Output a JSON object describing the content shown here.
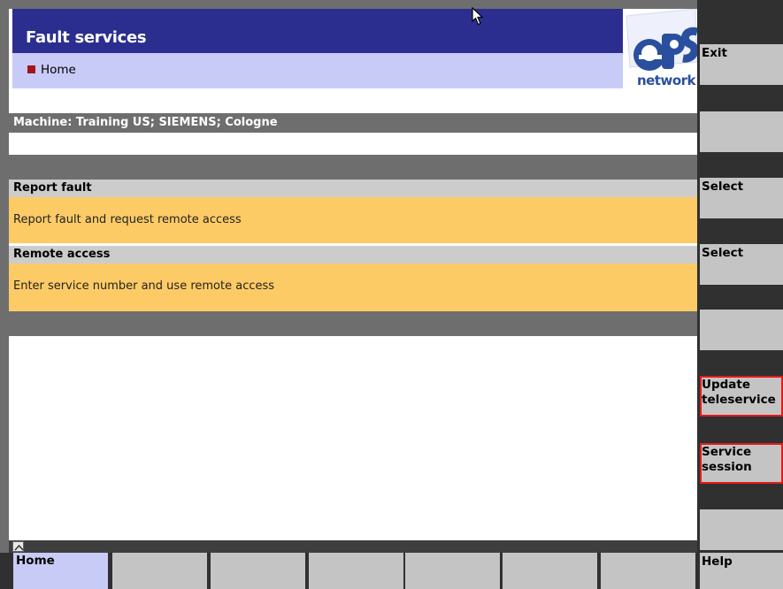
{
  "header": {
    "title": "Fault services",
    "breadcrumb": "Home",
    "logo_text": "network",
    "logo_mark": "ePS"
  },
  "machine": "Machine: Training US; SIEMENS; Cologne",
  "sections": [
    {
      "header": "Report fault",
      "item": "Report fault and request remote access"
    },
    {
      "header": "Remote access",
      "item": "Enter service number and use remote access"
    }
  ],
  "vertical_softkeys": [
    {
      "label": "Exit"
    },
    {
      "label": ""
    },
    {
      "label": "Select"
    },
    {
      "label": "Select"
    },
    {
      "label": ""
    },
    {
      "label": "Update teleservice"
    },
    {
      "label": "Service session"
    },
    {
      "label": ""
    }
  ],
  "horizontal_softkeys": [
    {
      "label": "Home"
    },
    {
      "label": ""
    },
    {
      "label": ""
    },
    {
      "label": ""
    },
    {
      "label": ""
    },
    {
      "label": ""
    },
    {
      "label": ""
    },
    {
      "label": "Help"
    }
  ],
  "colors": {
    "title_bar": "#2b2e8e",
    "breadcrumb_bg": "#c9cbf7",
    "section_item_bg": "#fdcb66",
    "softkey_bg": "#c4c4c4",
    "softkey_highlight_border": "#e31b1b",
    "logo_blue": "#2a4f9e"
  },
  "icons": {
    "breadcrumb_bullet": "red-square-bullet-icon",
    "scroll": "scroll-up-arrow-icon",
    "cursor": "mouse-pointer-icon"
  }
}
